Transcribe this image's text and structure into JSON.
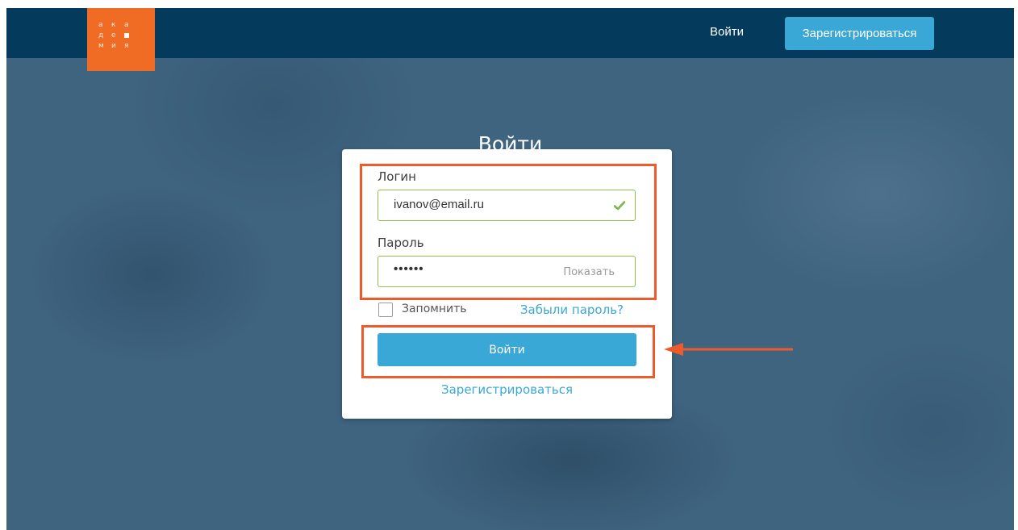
{
  "header": {
    "logo_letters": [
      [
        "а",
        "к",
        "а"
      ],
      [
        "д",
        "е",
        "■"
      ],
      [
        "м",
        "и",
        "я"
      ]
    ],
    "login_label": "Войти",
    "register_label": "Зарегистрироваться"
  },
  "login_form": {
    "title": "Войти",
    "login_label": "Логин",
    "login_value": "ivanov@email.ru",
    "password_label": "Пароль",
    "password_value": "••••••",
    "show_password_label": "Показать",
    "remember_label": "Запомнить",
    "forgot_label": "Забыли пароль?",
    "submit_label": "Войти",
    "register_label": "Зарегистрироваться"
  },
  "icons": {
    "valid": "check-icon",
    "annotation": "arrow-left-icon"
  },
  "colors": {
    "header_bg": "#043a5b",
    "logo_bg": "#f06b23",
    "accent": "#3aa8d6",
    "valid_border": "#8cc152",
    "annotation": "#ef5a2a"
  }
}
